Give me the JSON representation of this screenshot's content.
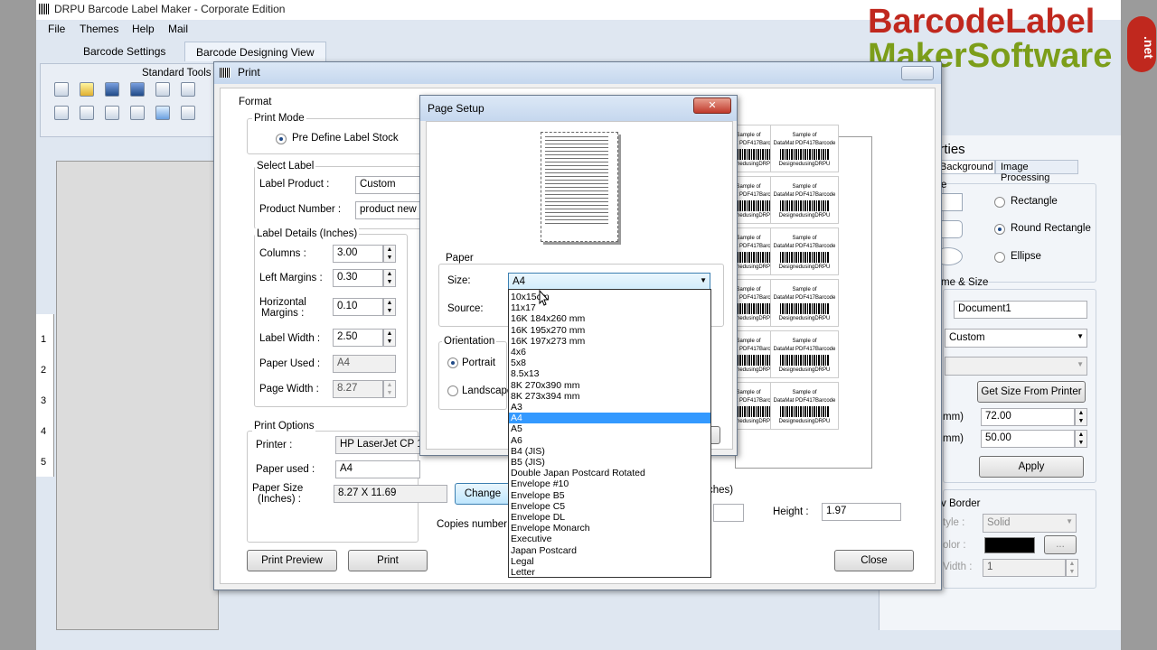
{
  "app": {
    "title": "DRPU Barcode Label Maker - Corporate Edition",
    "menu": [
      "File",
      "Themes",
      "Help",
      "Mail"
    ],
    "tabs": [
      "Barcode Settings",
      "Barcode Designing View"
    ],
    "toolbar_title": "Standard Tools",
    "ruler_numbers": [
      "1",
      "2",
      "3",
      "4",
      "5"
    ]
  },
  "logo": {
    "line1_a": "Barcode",
    "line1_b": "Label",
    "line2": "MakerSoftware",
    "badge": ".net"
  },
  "right_panel": {
    "title_partial": "erties",
    "tabs": [
      "Background",
      "Image Processing"
    ],
    "shape_partial": "e",
    "shapes": [
      "Rectangle",
      "Round Rectangle",
      "Ellipse"
    ],
    "shape_selected": "Round Rectangle",
    "section_name_size": "me & Size",
    "document_name": "Document1",
    "size_combo": "Custom",
    "get_size_button": "Get Size From Printer",
    "width_unit": "mm)",
    "width_value": "72.00",
    "height_unit": "mm)",
    "height_value": "50.00",
    "apply_button": "Apply",
    "border_section": "v Border",
    "style_label": "tyle :",
    "style_value": "Solid",
    "color_label": "olor :",
    "ellipsis_button": "...",
    "width_label": "Vidth :",
    "width_border_value": "1",
    "border_color": "#000000"
  },
  "print_dialog": {
    "title": "Print",
    "format_label": "Format",
    "print_mode_label": "Print Mode",
    "print_mode_option": "Pre Define Label Stock",
    "select_label": "Select Label",
    "label_product_label": "Label Product :",
    "label_product_value": "Custom",
    "product_number_label": "Product Number :",
    "product_number_value": "product new",
    "label_details": "Label Details (Inches)",
    "columns_label": "Columns :",
    "columns_value": "3.00",
    "left_margins_label": "Left Margins :",
    "left_margins_value": "0.30",
    "horizontal_margins_label_1": "Horizontal",
    "horizontal_margins_label_2": "Margins :",
    "horizontal_margins_value": "0.10",
    "label_width_label": "Label Width :",
    "label_width_value": "2.50",
    "paper_used_label": "Paper Used :",
    "paper_used_value": "A4",
    "page_width_label": "Page Width :",
    "page_width_value": "8.27",
    "print_options": "Print Options",
    "printer_label": "Printer :",
    "printer_value": "HP LaserJet CP 102",
    "paper_used2_label": "Paper used :",
    "paper_used2_value": "A4",
    "paper_size_label_1": "Paper Size",
    "paper_size_label_2": "(Inches) :",
    "paper_size_value": "8.27 X 11.69",
    "change_button": "Change",
    "copies_label": "Copies number",
    "inches_partial": "ches)",
    "height_label": "Height :",
    "height_value": "1.97",
    "print_preview_button": "Print Preview",
    "print_button": "Print",
    "close_button": "Close",
    "sample_text_1": "Sample of",
    "sample_text_2": "DataMat PDF417Barcode",
    "sample_text_3": "DesignedusingDRPU"
  },
  "page_setup": {
    "title": "Page Setup",
    "close_icon": "✕",
    "paper_label": "Paper",
    "size_label": "Size:",
    "size_value": "A4",
    "source_label": "Source:",
    "orientation_label": "Orientation",
    "portrait_label": "Portrait",
    "landscape_label": "Landscape",
    "orientation_selected": "Portrait",
    "size_options": [
      "10x15cm",
      "11x17",
      "16K 184x260 mm",
      "16K 195x270 mm",
      "16K 197x273 mm",
      "4x6",
      "5x8",
      "8.5x13",
      "8K 270x390 mm",
      "8K 273x394 mm",
      "A3",
      "A4",
      "A5",
      "A6",
      "B4 (JIS)",
      "B5 (JIS)",
      "Double Japan Postcard Rotated",
      "Envelope #10",
      "Envelope B5",
      "Envelope C5",
      "Envelope DL",
      "Envelope Monarch",
      "Executive",
      "Japan Postcard",
      "Legal",
      "Letter"
    ],
    "selected_index": 11
  }
}
